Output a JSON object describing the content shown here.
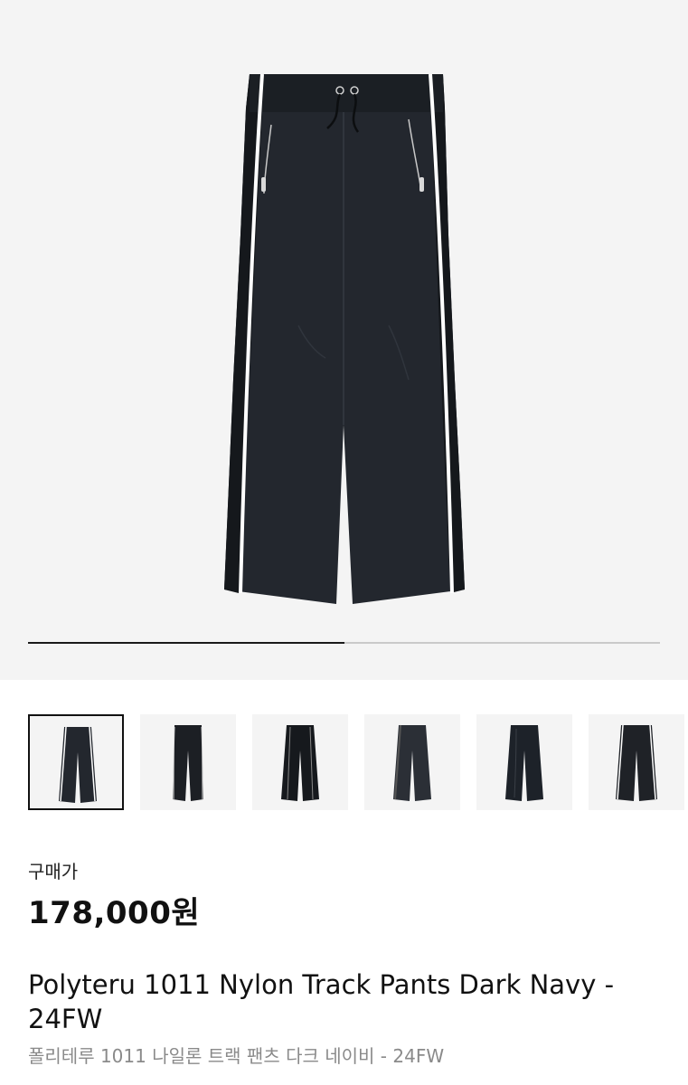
{
  "product": {
    "image_alt": "Polyteru 1011 Nylon Track Pants Dark Navy",
    "carousel_progress": 0.5,
    "thumbnails": [
      {
        "name": "thumb-1",
        "selected": true
      },
      {
        "name": "thumb-2",
        "selected": false
      },
      {
        "name": "thumb-3",
        "selected": false
      },
      {
        "name": "thumb-4",
        "selected": false
      },
      {
        "name": "thumb-5",
        "selected": false
      },
      {
        "name": "thumb-6",
        "selected": false
      }
    ],
    "price_label": "구매가",
    "price": "178,000원",
    "title": "Polyteru 1011 Nylon Track Pants Dark Navy - 24FW",
    "subtitle": "폴리테루 1011 나일론 트랙 팬츠 다크 네이비 - 24FW"
  },
  "colors": {
    "pants": "#23272e",
    "pants_dark": "#15181c",
    "stripe": "#ffffff",
    "background": "#f4f4f4",
    "progress_fill": "#1a1a1a",
    "progress_track": "#c9c9c9"
  }
}
